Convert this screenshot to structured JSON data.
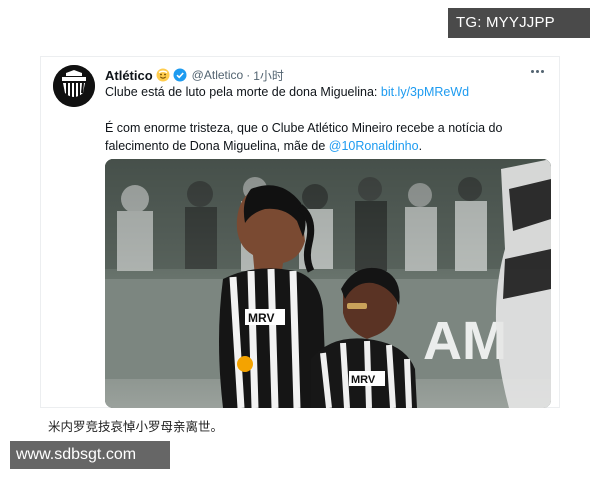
{
  "badge": {
    "text": "TG: MYYJJPP"
  },
  "tweet": {
    "author_name": "Atlético",
    "handle": "@Atletico",
    "separator": "·",
    "time": "1小时",
    "line1_text": "Clube está de luto pela morte de dona Miguelina: ",
    "line1_link": "bit.ly/3pMReWd",
    "para_line1": "É com enorme tristeza, que o Clube Atlético Mineiro recebe a notícia do",
    "para_line2_text": "falecimento de Dona Miguelina, mãe de ",
    "para_mention": "@10Ronaldinho",
    "para_end": ".",
    "photo_stadium_text": "AM",
    "photo_jersey_text_1": "MRV",
    "photo_jersey_text_2": "MRV"
  },
  "caption": {
    "text": "米内罗竞技哀悼小罗母亲离世。"
  },
  "watermark": {
    "text": "www.sdbsgt.com"
  },
  "colors": {
    "link": "#1d9bf0",
    "secondary_text": "#536471",
    "verified": "#1d9bf0",
    "badge_bg": "#4a4a4a",
    "watermark_bg": "#666666"
  },
  "icons": [
    "club-crest-icon",
    "smile-emoji-icon",
    "verified-badge-icon",
    "more-options-icon"
  ]
}
